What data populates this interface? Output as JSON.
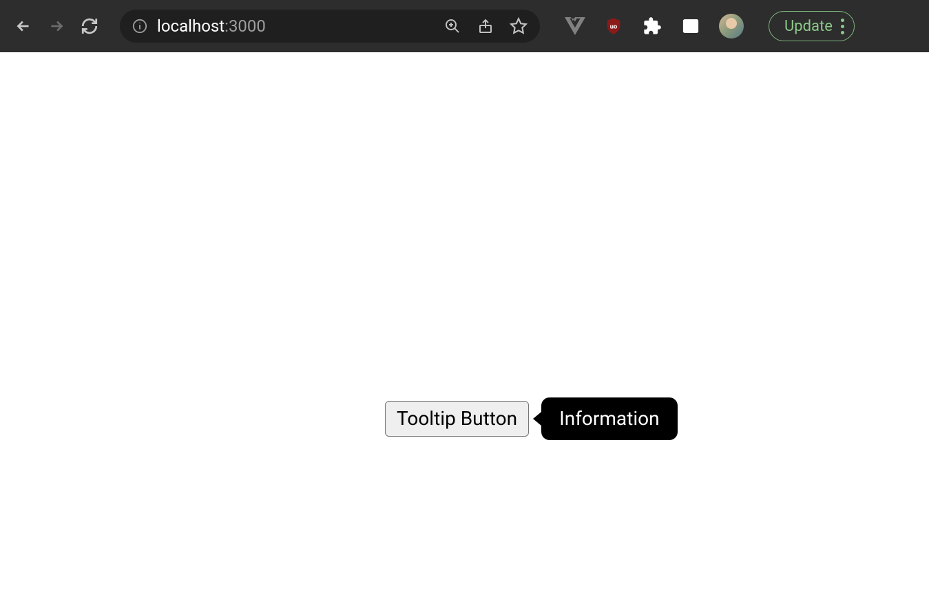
{
  "browser": {
    "url_host": "localhost",
    "url_port": ":3000",
    "update_label": "Update"
  },
  "page": {
    "button_label": "Tooltip Button",
    "tooltip_text": "Information"
  }
}
